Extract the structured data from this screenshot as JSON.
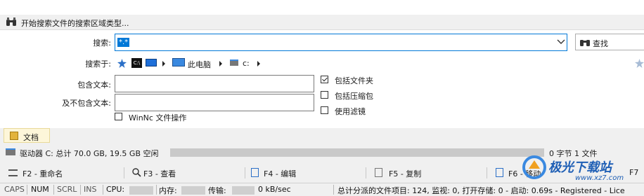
{
  "search_header": {
    "title": "开始搜索文件的搜索区域类型..."
  },
  "form": {
    "search_label": "搜索:",
    "search_value": "*.*",
    "find_button": "查找",
    "search_in_label": "搜索于:",
    "path": {
      "cmd_icon": "C:\\",
      "this_pc": "此电脑",
      "drive": "c:"
    },
    "contains_label": "包含文本:",
    "not_contains_label": "及不包含文本:",
    "winnc_label": "WinNc 文件操作",
    "options": [
      {
        "label": "包括文件夹",
        "checked": true
      },
      {
        "label": "包括压缩包",
        "checked": false
      },
      {
        "label": "使用滤镜",
        "checked": false
      }
    ],
    "winnc_checked": false
  },
  "tabs": {
    "documents": "文档"
  },
  "drive_bar": {
    "label": "驱动器 C: 总计 70.0 GB, 19.5 GB 空闲",
    "summary": "0 字节 1 文件",
    "free_fraction": 0.279
  },
  "fkeys": {
    "f2": "F2 - 重命名",
    "f3": "F3 - 查看",
    "f4": "F4 - 编辑",
    "f5": "F5 - 复制",
    "f6": "F6 - 移动",
    "f7": "F7"
  },
  "status": {
    "caps": "CAPS",
    "num": "NUM",
    "scrl": "SCRL",
    "ins": "INS",
    "cpu_label": "CPU:",
    "mem_label": "内存:",
    "transfer_label": "传输:",
    "transfer_value": "0 kB/sec",
    "summary": "总计分派的文件项目: 124, 监视: 0, 打开存储: 0 - 启动: 0.69s - Registered - Lice"
  },
  "watermark": {
    "brand": "极光下载站",
    "url": "www.xz7.com"
  },
  "colors": {
    "accent": "#0078d7",
    "tab_bg": "#fdf6d9"
  }
}
